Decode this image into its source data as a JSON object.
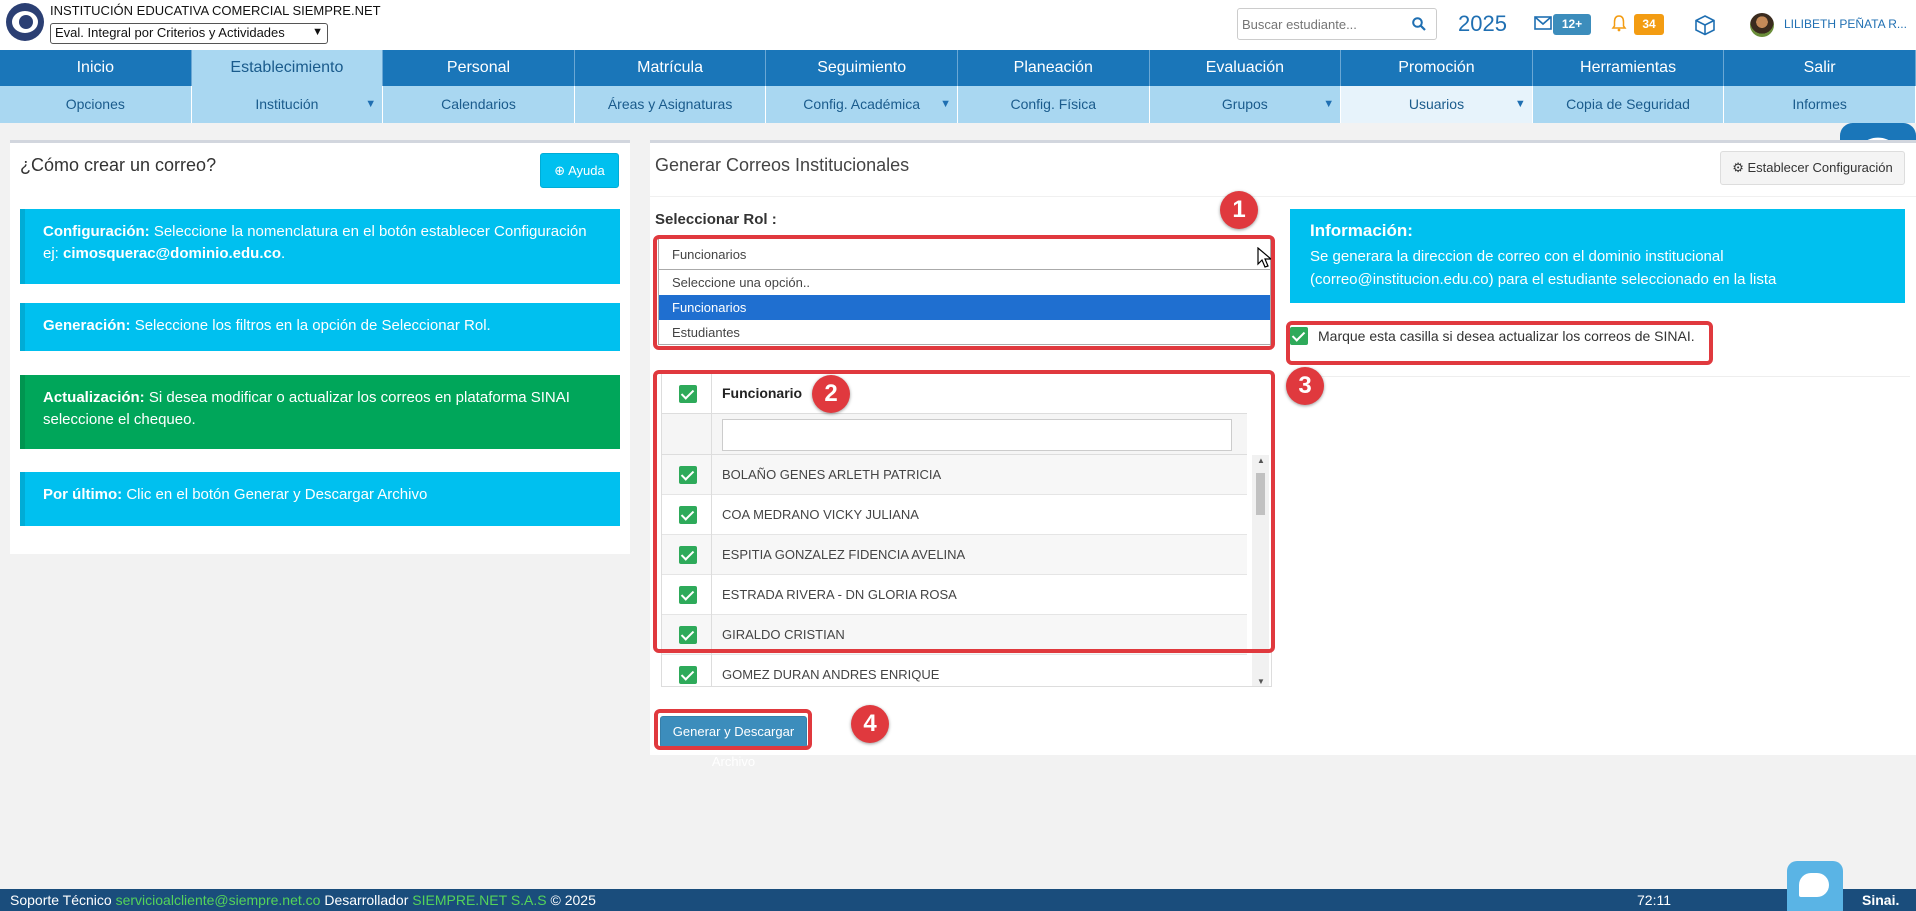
{
  "header": {
    "institution": "INSTITUCIÓN EDUCATIVA COMERCIAL SIEMPRE.NET",
    "mode_select": "Eval. Integral por Criterios y Actividades",
    "search_placeholder": "Buscar estudiante...",
    "year": "2025",
    "messages_badge": "12+",
    "notifications_badge": "34",
    "user_name": "LILIBETH PEÑATA R..."
  },
  "nav": {
    "main": [
      "Inicio",
      "Establecimiento",
      "Personal",
      "Matrícula",
      "Seguimiento",
      "Planeación",
      "Evaluación",
      "Promoción",
      "Herramientas",
      "Salir"
    ],
    "sub": [
      "Opciones",
      "Institución",
      "Calendarios",
      "Áreas y Asignaturas",
      "Config. Académica",
      "Config. Física",
      "Grupos",
      "Usuarios",
      "Copia de Seguridad",
      "Informes"
    ]
  },
  "left": {
    "title": "¿Cómo crear un correo?",
    "help_label": "Ayuda",
    "cards": {
      "config_bold": "Configuración:",
      "config_text": " Seleccione la nomenclatura en el botón establecer Configuración ej: ",
      "config_email": "cimosquerac@dominio.edu.co",
      "config_end": ".",
      "gen_bold": "Generación:",
      "gen_text": " Seleccione los filtros en la opción de Seleccionar Rol.",
      "upd_bold": "Actualización:",
      "upd_text": " Si desea modificar o actualizar los correos en plataforma SINAI seleccione el chequeo.",
      "last_bold": "Por último:",
      "last_text": " Clic en el botón Generar y Descargar Archivo"
    }
  },
  "right": {
    "title": "Generar Correos Institucionales",
    "config_button": "Establecer Configuración",
    "role_label": "Seleccionar Rol :",
    "role_value": "Funcionarios",
    "role_options": [
      "Seleccione una opción..",
      "Funcionarios",
      "Estudiantes"
    ],
    "grid_header": "Funcionario",
    "staff": [
      "BOLAÑO GENES ARLETH PATRICIA",
      "COA MEDRANO VICKY JULIANA",
      "ESPITIA GONZALEZ FIDENCIA AVELINA",
      "ESTRADA RIVERA - DN GLORIA ROSA",
      "GIRALDO CRISTIAN",
      "GOMEZ DURAN ANDRES ENRIQUE"
    ],
    "generate_button": "Generar y Descargar Archivo",
    "info_title": "Información:",
    "info_text": "Se generara la direccion de correo con el dominio institucional (correo@institucion.edu.co) para el estudiante seleccionado en la lista",
    "sinai_label": "Marque esta casilla si desea actualizar los correos de SINAI."
  },
  "markers": [
    "1",
    "2",
    "3",
    "4"
  ],
  "footer": {
    "support_label": "Soporte Técnico",
    "support_email": "servicioalcliente@siempre.net.co",
    "developer_label": "Desarrollador",
    "developer_name": "SIEMPRE.NET S.A.S",
    "copyright": "© 2025",
    "time": "72:11",
    "brand": "Sinai."
  },
  "colors": {
    "primary": "#1a76b9",
    "nav_light": "#a9d7f1",
    "info": "#00c0ef",
    "success": "#00a65a",
    "callout": "#e0393e",
    "footer": "#1a4d7c"
  }
}
